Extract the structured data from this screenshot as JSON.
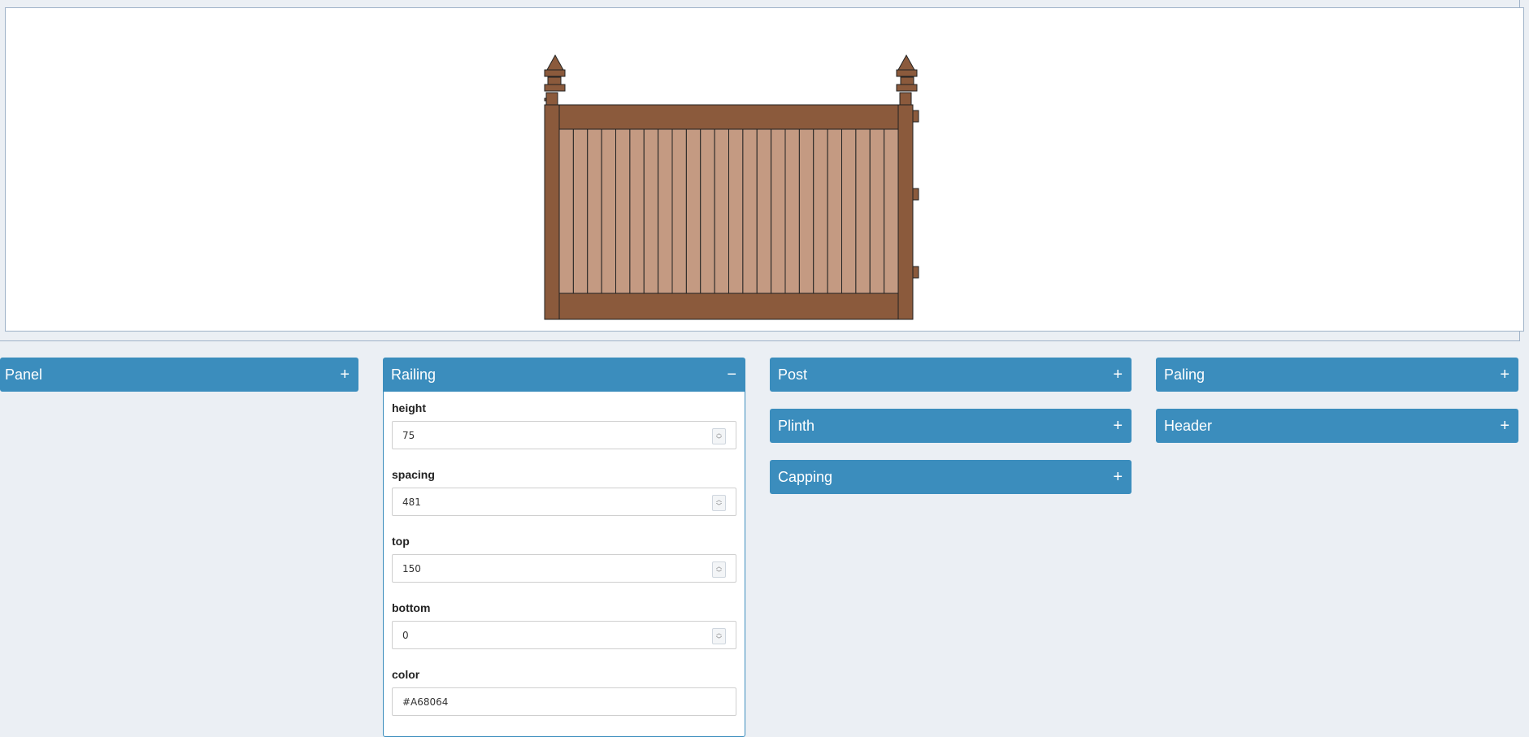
{
  "colors": {
    "accent": "#3b8dbd",
    "background": "#ebeff4",
    "railing": "#A68064",
    "post": "#8b5a3c",
    "paling": "#c49a82"
  },
  "panels": {
    "panel": {
      "title": "Panel",
      "toggle": "+"
    },
    "railing": {
      "title": "Railing",
      "toggle": "−"
    },
    "post": {
      "title": "Post",
      "toggle": "+"
    },
    "plinth": {
      "title": "Plinth",
      "toggle": "+"
    },
    "capping": {
      "title": "Capping",
      "toggle": "+"
    },
    "paling": {
      "title": "Paling",
      "toggle": "+"
    },
    "header": {
      "title": "Header",
      "toggle": "+"
    }
  },
  "railing_fields": {
    "height": {
      "label": "height",
      "value": "75"
    },
    "spacing": {
      "label": "spacing",
      "value": "481"
    },
    "top": {
      "label": "top",
      "value": "150"
    },
    "bottom": {
      "label": "bottom",
      "value": "0"
    },
    "color": {
      "label": "color",
      "value": "#A68064"
    }
  },
  "icons": {
    "spinner_up": "chevron-up-icon",
    "spinner_down": "chevron-down-icon"
  }
}
